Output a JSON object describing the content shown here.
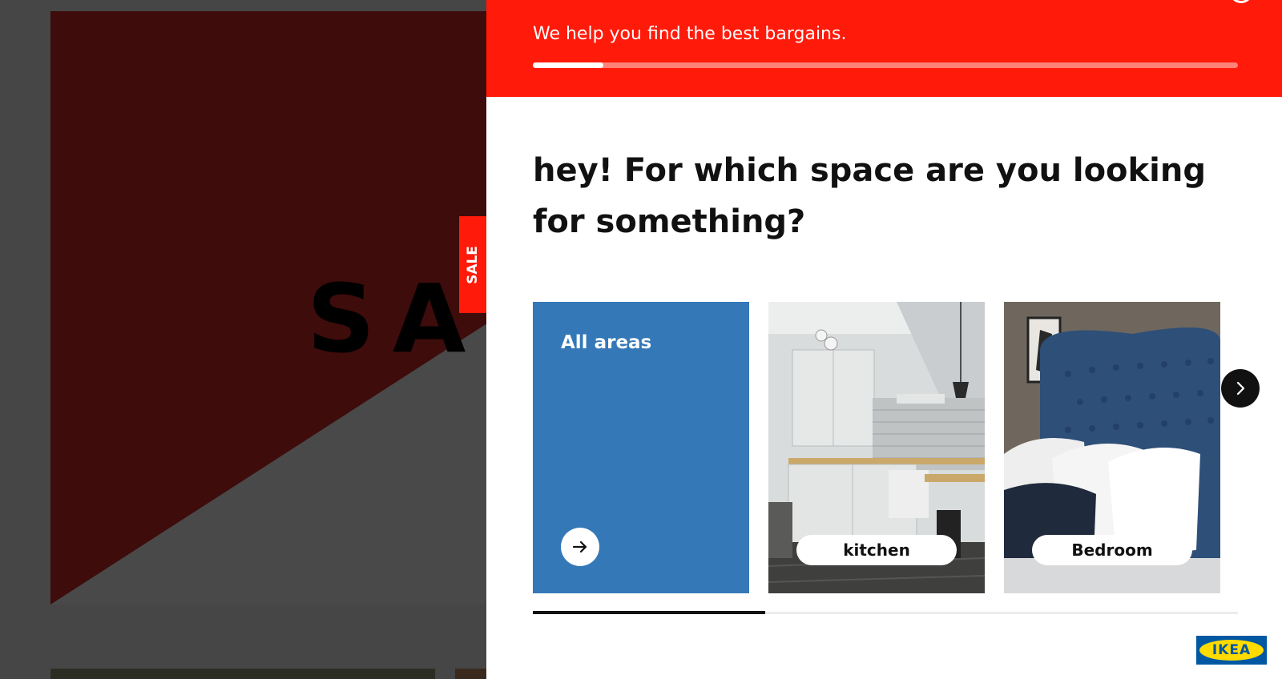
{
  "background": {
    "banner_word": "SAL",
    "sale_tab_label": "SALE"
  },
  "panel": {
    "header_text": "We help you find the best bargains.",
    "progress_fraction": 0.1,
    "question": "hey! For which space are you looking for something?",
    "cards": [
      {
        "label": "All areas",
        "type": "all"
      },
      {
        "label": "kitchen",
        "type": "image"
      },
      {
        "label": "Bedroom",
        "type": "image"
      }
    ],
    "scroll_fraction": 0.33,
    "logo_text": "IKEA"
  },
  "colors": {
    "accent_red": "#ff1a0a",
    "card_blue": "#3478b8",
    "ikea_blue": "#0058a3",
    "ikea_yellow": "#ffdb00"
  },
  "icons": [
    "arrow-right-icon",
    "chevron-right-icon",
    "ikea-logo"
  ]
}
